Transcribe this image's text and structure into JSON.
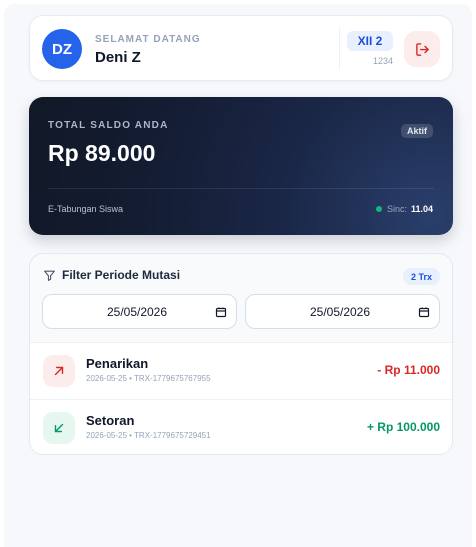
{
  "header": {
    "avatar_initials": "DZ",
    "welcome_text": "SELAMAT DATANG",
    "user_name": "Deni Z",
    "class_label": "XII 2",
    "class_code": "1234",
    "logout_icon": "logout-icon"
  },
  "balance": {
    "label": "TOTAL SALDO ANDA",
    "amount": "Rp 89.000",
    "status": "Aktif",
    "footer_label": "E-Tabungan Siswa",
    "sync_label": "Sinc:",
    "sync_time": "11.04"
  },
  "filter": {
    "title": "Filter Periode Mutasi",
    "count_badge": "2 Trx",
    "start_date": "25/05/2026",
    "end_date": "25/05/2026",
    "filter_icon": "filter-icon",
    "calendar_icon": "calendar-icon"
  },
  "transactions": [
    {
      "type": "Penarikan",
      "date": "2026-05-25",
      "ref": "TRX-1779675767955",
      "amount": "- Rp 11.000",
      "icon": "arrow-up-right-icon",
      "color": "#dc2626",
      "icon_bg": "#fdecec"
    },
    {
      "type": "Setoran",
      "date": "2026-05-25",
      "ref": "TRX-1779675729451",
      "amount": "+ Rp 100.000",
      "icon": "arrow-down-left-icon",
      "color": "#059669",
      "icon_bg": "#e6f7f0"
    }
  ],
  "colors": {
    "accent": "#2563eb",
    "danger": "#dc2626",
    "success": "#059669",
    "card_dark": "#111827"
  }
}
